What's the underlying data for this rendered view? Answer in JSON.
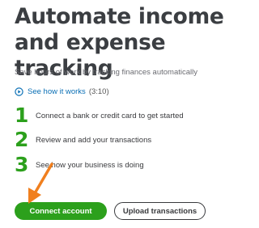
{
  "headline": "Automate income and expense tracking",
  "subtitle": "Save hours of work by tracking finances automatically",
  "video": {
    "icon": "play-circle-icon",
    "label": "See how it works",
    "duration": "(3:10)"
  },
  "steps": [
    {
      "number": "1",
      "text": "Connect a bank or credit card to get started"
    },
    {
      "number": "2",
      "text": "Review and add your transactions"
    },
    {
      "number": "3",
      "text": "See how your business is doing"
    }
  ],
  "buttons": {
    "primary": "Connect account",
    "secondary": "Upload transactions"
  },
  "colors": {
    "accent_green": "#2ca01c",
    "link_blue": "#0a6fb5",
    "annotation_arrow": "#f07f1e"
  }
}
